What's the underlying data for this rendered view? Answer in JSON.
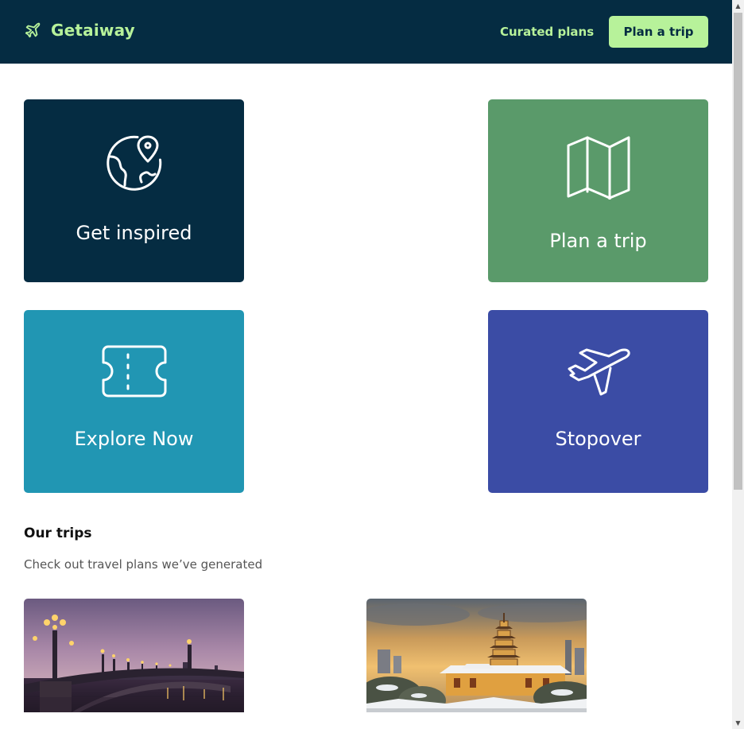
{
  "nav": {
    "brand": "Getaiway",
    "brand_icon": "plane-icon",
    "links": [
      {
        "label": "Curated plans"
      }
    ],
    "cta_label": "Plan a trip"
  },
  "cards": [
    {
      "title": "Get inspired",
      "icon": "globe-pin-icon",
      "color": "#052c42"
    },
    {
      "title": "Plan a trip",
      "icon": "map-icon",
      "color": "#5a9a6a"
    },
    {
      "title": "Explore Now",
      "icon": "ticket-icon",
      "color": "#2196b3"
    },
    {
      "title": "Stopover",
      "icon": "plane-icon",
      "color": "#3b4ca5"
    }
  ],
  "trips": {
    "title": "Our trips",
    "subtitle": "Check out travel plans we’ve generated",
    "items": [
      {
        "image": "paris-bridge-photo"
      },
      {
        "image": "pagoda-snow-photo"
      }
    ]
  },
  "colors": {
    "navbar_bg": "#052c42",
    "accent": "#b7f29a"
  }
}
